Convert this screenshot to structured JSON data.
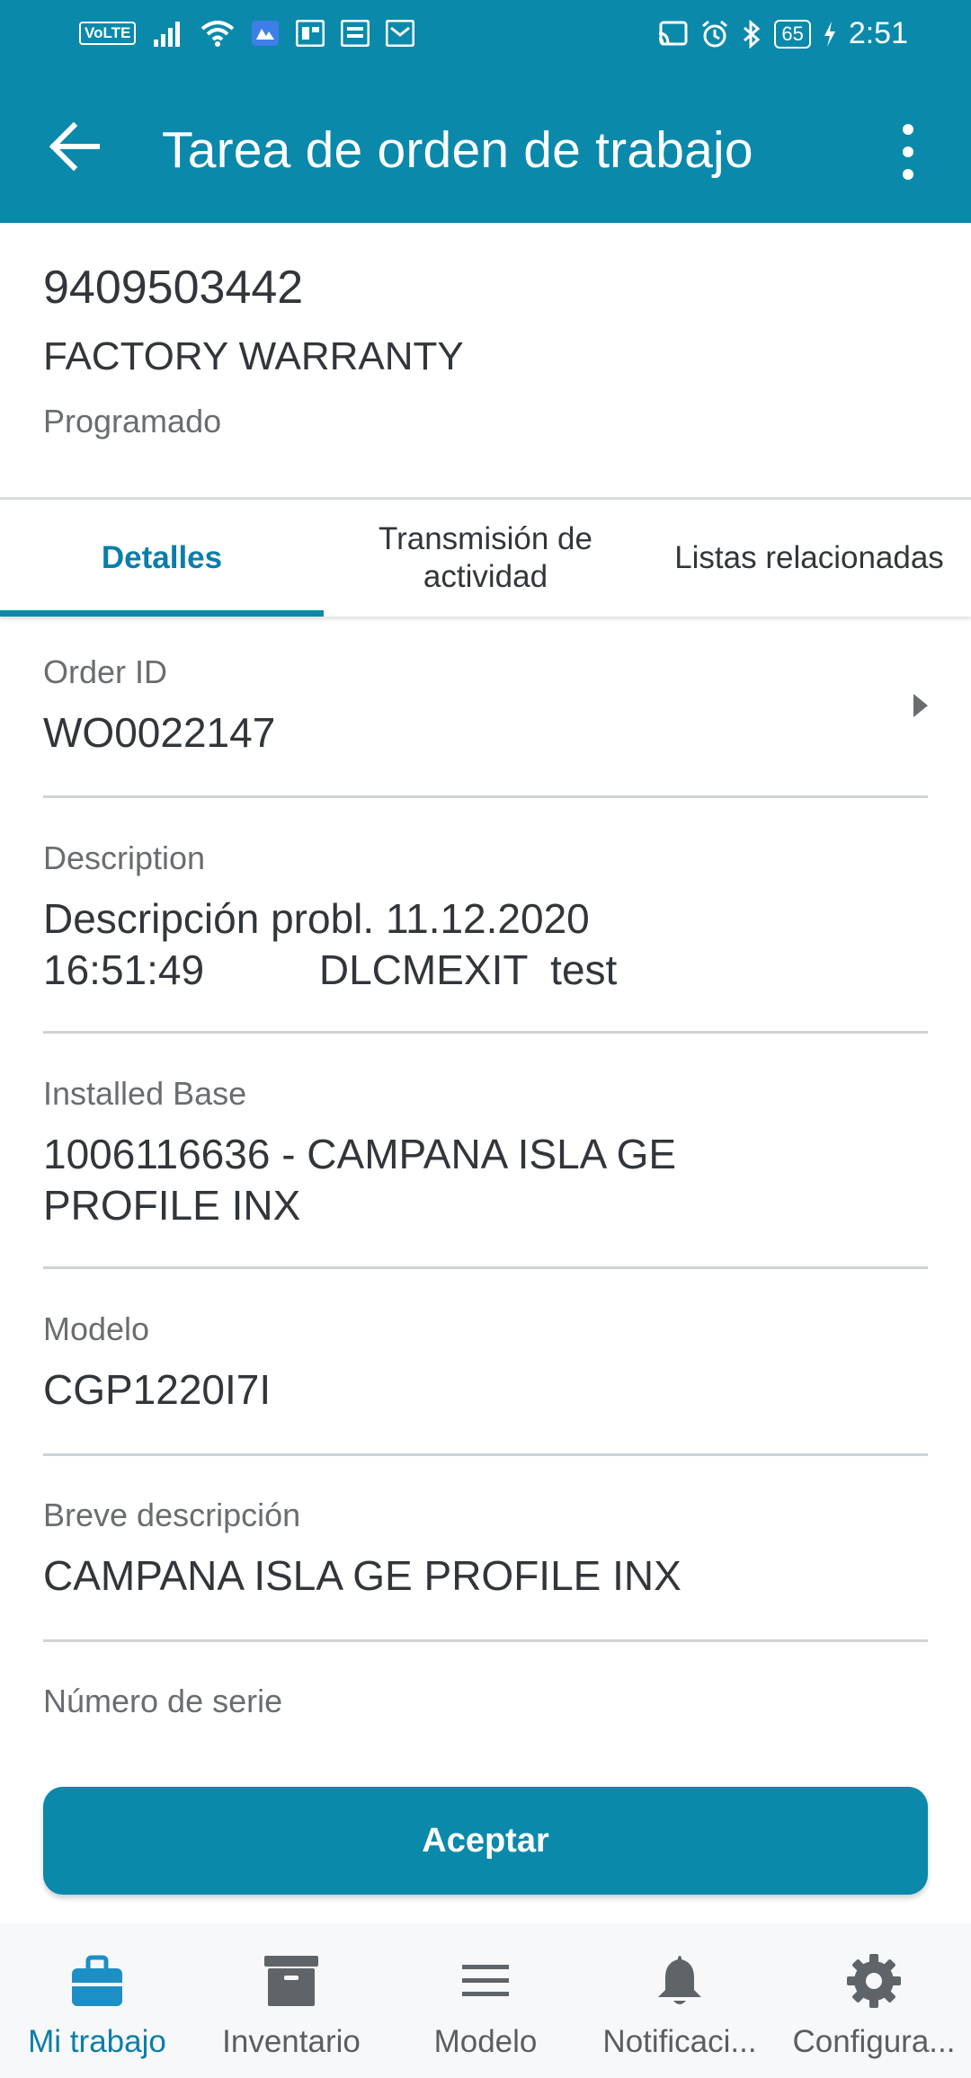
{
  "status_bar": {
    "left_chips": [
      "VoLTE",
      "signal-icon",
      "wifi-icon",
      "app-icon",
      "office-icon",
      "news-icon",
      "mail-icon"
    ],
    "volte_label": "VoLTE",
    "battery": "65",
    "time": "2:51"
  },
  "appbar": {
    "title": "Tarea de orden de trabajo",
    "color": "#0a89ab"
  },
  "header": {
    "number": "9409503442",
    "type": "FACTORY WARRANTY",
    "status": "Programado"
  },
  "tabs": [
    {
      "label": "Detalles",
      "active": true
    },
    {
      "label": "Transmisión de\nactividad",
      "active": false
    },
    {
      "label": "Listas relacionadas",
      "active": false
    }
  ],
  "fields": {
    "order_id": {
      "label": "Order ID",
      "value": "WO0022147"
    },
    "description": {
      "label": "Description",
      "value": "Descripción probl. 11.12.2020\n16:51:49          DLCMEXIT  test"
    },
    "installed_base": {
      "label": "Installed Base",
      "value": "1006116636 - CAMPANA ISLA GE\nPROFILE INX"
    },
    "modelo": {
      "label": "Modelo",
      "value": "CGP1220I7I"
    },
    "breve": {
      "label": "Breve descripción",
      "value": "CAMPANA ISLA GE PROFILE INX"
    },
    "serie": {
      "label": "Número de serie",
      "value": ""
    }
  },
  "accept_button": "Aceptar",
  "bottom_nav": [
    {
      "label": "Mi trabajo",
      "icon": "briefcase-icon",
      "active": true
    },
    {
      "label": "Inventario",
      "icon": "archive-box-icon",
      "active": false
    },
    {
      "label": "Modelo",
      "icon": "menu-lines-icon",
      "active": false
    },
    {
      "label": "Notificaci...",
      "icon": "bell-icon",
      "active": false
    },
    {
      "label": "Configura...",
      "icon": "gear-icon",
      "active": false
    }
  ]
}
